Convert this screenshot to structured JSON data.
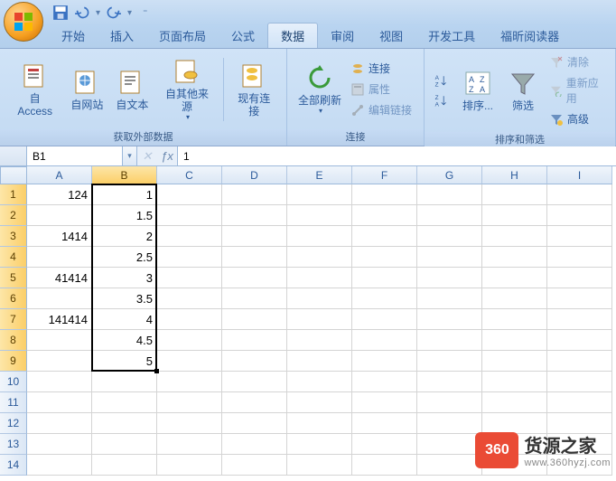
{
  "qat": {
    "save": "save-icon",
    "undo": "undo-icon",
    "redo": "redo-icon"
  },
  "tabs": [
    {
      "label": "开始"
    },
    {
      "label": "插入"
    },
    {
      "label": "页面布局"
    },
    {
      "label": "公式"
    },
    {
      "label": "数据",
      "active": true
    },
    {
      "label": "审阅"
    },
    {
      "label": "视图"
    },
    {
      "label": "开发工具"
    },
    {
      "label": "福昕阅读器"
    }
  ],
  "ribbon": {
    "group1": {
      "label": "获取外部数据",
      "btns": [
        "自 Access",
        "自网站",
        "自文本",
        "自其他来源",
        "现有连接"
      ]
    },
    "group2": {
      "label": "连接",
      "refresh": "全部刷新",
      "items": [
        "连接",
        "属性",
        "编辑链接"
      ]
    },
    "group3": {
      "label": "排序和筛选",
      "sort": "排序...",
      "filter": "筛选",
      "items": [
        "清除",
        "重新应用",
        "高级"
      ]
    }
  },
  "namebox": "B1",
  "formula": "1",
  "columns": [
    "A",
    "B",
    "C",
    "D",
    "E",
    "F",
    "G",
    "H",
    "I"
  ],
  "rows": 14,
  "selectedCol": 1,
  "selectedRowsUntil": 9,
  "cells": {
    "A": {
      "1": "124",
      "3": "1414",
      "5": "41414",
      "7": "141414"
    },
    "B": {
      "1": "1",
      "2": "1.5",
      "3": "2",
      "4": "2.5",
      "5": "3",
      "6": "3.5",
      "7": "4",
      "8": "4.5",
      "9": "5"
    }
  },
  "selection": {
    "col": 1,
    "rowStart": 1,
    "rowEnd": 9
  },
  "watermark": {
    "badge": "360",
    "title": "货源之家",
    "url": "www.360hyzj.com"
  }
}
